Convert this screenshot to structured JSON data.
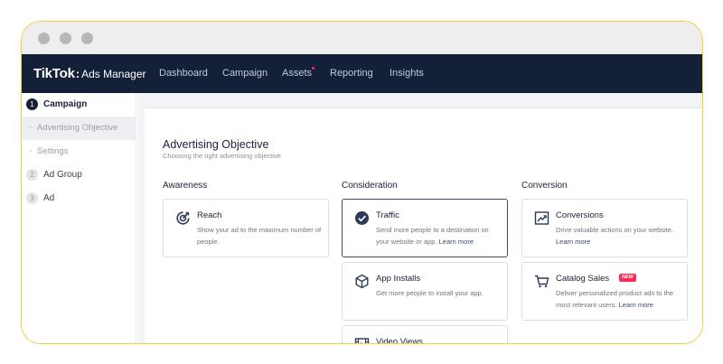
{
  "nav": {
    "brand": "TikTok",
    "brand_separator": ":",
    "product": "Ads Manager",
    "items": [
      {
        "label": "Dashboard"
      },
      {
        "label": "Campaign"
      },
      {
        "label": "Assets"
      },
      {
        "label": "Reporting"
      },
      {
        "label": "Insights"
      }
    ]
  },
  "sidebar": {
    "campaign": {
      "num": "1",
      "label": "Campaign"
    },
    "sub_dash": "-",
    "sub_items": [
      {
        "label": "Advertising Objective"
      },
      {
        "label": "Settings"
      }
    ],
    "ad_group": {
      "num": "2",
      "label": "Ad Group"
    },
    "ad": {
      "num": "3",
      "label": "Ad"
    }
  },
  "objective": {
    "title": "Advertising Objective",
    "subtitle": "Choosing the right advertising objective",
    "columns": {
      "awareness": "Awareness",
      "consideration": "Consideration",
      "conversion": "Conversion"
    },
    "cards": {
      "reach": {
        "title": "Reach",
        "desc": "Show your ad to the maximum number of people.",
        "icon": "target-icon"
      },
      "traffic": {
        "title": "Traffic",
        "desc": "Send more people to a destination on your website or app.",
        "link": "Learn more",
        "icon": "check-circle-icon"
      },
      "app_installs": {
        "title": "App Installs",
        "desc": "Get more people to install your app.",
        "icon": "cube-icon"
      },
      "video_views": {
        "title": "Video Views",
        "icon": "film-icon"
      },
      "conversions": {
        "title": "Conversions",
        "desc": "Drive valuable actions on your website.",
        "link": "Learn more",
        "icon": "trend-chart-icon"
      },
      "catalog_sales": {
        "title": "Catalog Sales",
        "badge": "NEW",
        "desc": "Deliver personalized product ads to the most relevant users.",
        "link": "Learn more",
        "icon": "cart-icon"
      }
    }
  },
  "colors": {
    "nav_bg": "#132038",
    "frame_border": "#f0cc3a",
    "accent": "#3b4a72",
    "badge": "#fe2c55"
  }
}
